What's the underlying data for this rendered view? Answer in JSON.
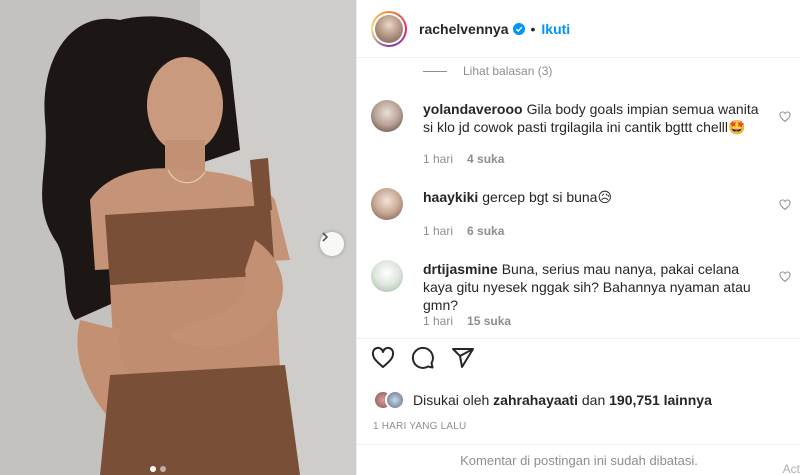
{
  "post": {
    "username": "rachelvennya",
    "follow_label": "Ikuti",
    "separator": "•",
    "carousel": {
      "total_slides": 2,
      "active_slide": 1
    }
  },
  "comments": {
    "view_replies_label": "Lihat balasan (3)",
    "items": [
      {
        "user": "yolandaverooo",
        "text": "Gila body goals impian semua wanita si klo jd cowok pasti trgilagila ini cantik bgttt chelll🤩",
        "time": "1 hari",
        "likes": "4 suka"
      },
      {
        "user": "haaykiki",
        "text": "gercep bgt si buna😥",
        "time": "1 hari",
        "likes": "6 suka"
      },
      {
        "user": "drtijasmine",
        "text": "Buna, serius mau nanya, pakai celana kaya gitu nyesek nggak sih? Bahannya nyaman atau gmn?",
        "time": "1 hari",
        "likes": "15 suka"
      }
    ]
  },
  "likes": {
    "prefix": "Disukai oleh",
    "liker": "zahrahayaati",
    "conjunction": "dan",
    "others": "190,751 lainnya"
  },
  "timestamp": "1 HARI YANG LALU",
  "footer_text": "Komentar di postingan ini sudah dibatasi.",
  "watermark": "Act",
  "colors": {
    "accent": "#0095f6",
    "text": "#262626",
    "muted": "#8e8e8e",
    "border": "#efefef"
  },
  "icons": [
    "verified-badge-icon",
    "chevron-right-icon",
    "heart-icon",
    "comment-icon",
    "share-icon"
  ]
}
